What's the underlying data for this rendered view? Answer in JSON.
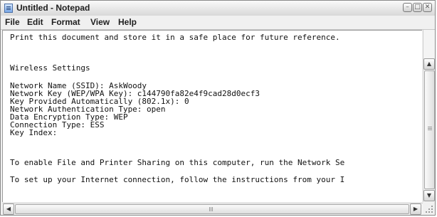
{
  "window": {
    "title": "Untitled - Notepad",
    "controls": {
      "minimize": "–",
      "maximize": "□",
      "close": "✕"
    }
  },
  "menu": {
    "file": "File",
    "edit": "Edit",
    "format": "Format",
    "view": "View",
    "help": "Help"
  },
  "document": {
    "lines": [
      "Print this document and store it in a safe place for future reference.",
      "",
      "",
      "Wireless Settings",
      "",
      "Network Name (SSID): AskWoody",
      "Network Key (WEP/WPA Key): c144790fa82e4f9cad28d0ecf3",
      "Key Provided Automatically (802.1x): 0",
      "Network Authentication Type: open",
      "Data Encryption Type: WEP",
      "Connection Type: ESS",
      "Key Index:",
      "",
      "",
      "To enable File and Printer Sharing on this computer, run the Network Se",
      "",
      "To set up your Internet connection, follow the instructions from your I"
    ]
  },
  "scrollbars": {
    "up_arrow": "▲",
    "down_arrow": "▼",
    "left_arrow": "◀",
    "right_arrow": "▶"
  }
}
